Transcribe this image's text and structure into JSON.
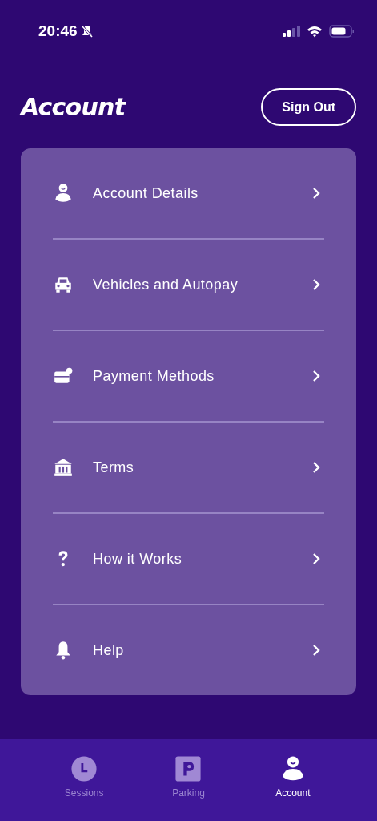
{
  "status_bar": {
    "time": "20:46"
  },
  "header": {
    "title": "Account",
    "sign_out": "Sign Out"
  },
  "menu": [
    {
      "kind": "person",
      "label": "Account Details"
    },
    {
      "kind": "car",
      "label": "Vehicles and Autopay"
    },
    {
      "kind": "card",
      "label": "Payment Methods"
    },
    {
      "kind": "bank",
      "label": "Terms"
    },
    {
      "kind": "question",
      "label": "How it Works"
    },
    {
      "kind": "bell",
      "label": "Help"
    }
  ],
  "tab_bar": [
    {
      "kind": "clock",
      "label": "Sessions",
      "selected": false
    },
    {
      "kind": "parking",
      "label": "Parking",
      "selected": false
    },
    {
      "kind": "person",
      "label": "Account",
      "selected": true
    }
  ]
}
